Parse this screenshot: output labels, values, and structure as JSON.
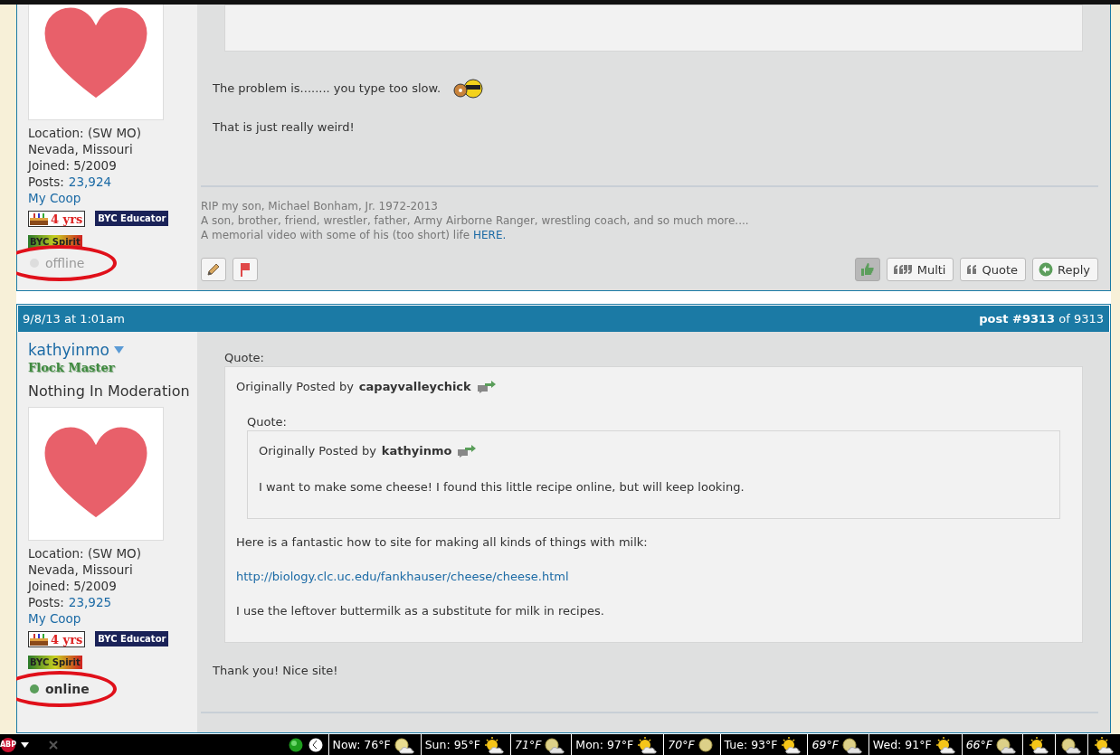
{
  "posts": [
    {
      "author": {
        "info": [
          "Location: (SW MO)",
          "Nevada, Missouri",
          "Joined: 5/2009"
        ],
        "posts_label": "Posts:",
        "posts_count": "23,924",
        "coop_link": "My Coop",
        "badges": [
          {
            "kind": "years",
            "text": "4 yrs"
          },
          {
            "kind": "educator",
            "text": "BYC Educator"
          },
          {
            "kind": "spirit",
            "text": "BYC Spirit"
          }
        ],
        "status": {
          "text": "offline",
          "online": false,
          "circled": true
        }
      },
      "content": [
        {
          "kind": "quote_end"
        },
        {
          "kind": "text",
          "text": "The problem is........ you type too slow.",
          "emoticon": true
        },
        {
          "kind": "text",
          "text": "That is just really weird!"
        }
      ],
      "signature": [
        {
          "text": "RIP my son, Michael Bonham, Jr. 1972-2013"
        },
        {
          "text": "A son, brother, friend, wrestler, father, Army Airborne Ranger, wrestling coach, and so much more...."
        },
        {
          "text": "A memorial video with some of his (too short) life",
          "link": "HERE."
        }
      ],
      "actions": [
        {
          "kind": "edit"
        },
        {
          "kind": "report"
        }
      ],
      "buttons": [
        {
          "kind": "like",
          "active": true
        },
        {
          "kind": "multi",
          "label": "Multi"
        },
        {
          "kind": "quote",
          "label": "Quote"
        },
        {
          "kind": "reply",
          "label": "Reply"
        }
      ]
    },
    {
      "header": {
        "date": "9/8/13 at 1:01am",
        "post_number": "**post #9313** of 9313"
      },
      "author": {
        "username": "kathyinmo",
        "title": "Flock Master",
        "motto": "Nothing In Moderation",
        "info": [
          "Location: (SW MO)",
          "Nevada, Missouri",
          "Joined: 5/2009"
        ],
        "posts_label": "Posts:",
        "posts_count": "23,925",
        "coop_link": "My Coop",
        "badges": [
          {
            "kind": "years",
            "text": "4 yrs"
          },
          {
            "kind": "educator",
            "text": "BYC Educator"
          },
          {
            "kind": "spirit",
            "text": "BYC Spirit"
          }
        ],
        "status": {
          "text": "online",
          "online": true,
          "circled": true
        }
      },
      "content": [
        {
          "kind": "quote",
          "label": "Quote:",
          "attribution": "Originally Posted by",
          "username": "capayvalleychick",
          "blocks": [
            {
              "kind": "quote",
              "label": "Quote:",
              "attribution": "Originally Posted by",
              "username": "kathyinmo",
              "blocks": [
                {
                  "kind": "text",
                  "text": "I want to make some cheese! I found this little recipe online, but will keep looking."
                }
              ]
            },
            {
              "kind": "text",
              "text": "Here is a fantastic how to site for making all kinds of things with milk:"
            },
            {
              "kind": "link",
              "text": "http://biology.clc.uc.edu/fankhauser/cheese/cheese.html"
            },
            {
              "kind": "text",
              "text": "I use the leftover buttermilk as a substitute for milk in recipes."
            }
          ]
        },
        {
          "kind": "text",
          "text": "Thank you! Nice site!"
        }
      ]
    }
  ],
  "taskbar": {
    "adblock": "ABP",
    "weather": [
      {
        "text": "Now: 76°F",
        "kind": "moon-cloud",
        "night": false
      },
      {
        "text": "Sun: 95°F",
        "kind": "sun-cloud",
        "night": false
      },
      {
        "text": "71°F",
        "kind": "moon-cloud",
        "night": true
      },
      {
        "text": "Mon: 97°F",
        "kind": "sun-cloud",
        "night": false
      },
      {
        "text": "70°F",
        "kind": "moon",
        "night": true
      },
      {
        "text": "Tue: 93°F",
        "kind": "sun-cloud",
        "night": false
      },
      {
        "text": "69°F",
        "kind": "moon-cloud",
        "night": true
      },
      {
        "text": "Wed: 91°F",
        "kind": "sun-cloud",
        "night": false
      },
      {
        "text": "66°F",
        "kind": "moon-cloud",
        "night": true
      },
      {
        "kind": "sun-cloud",
        "night": false
      },
      {
        "kind": "moon-cloud",
        "night": true
      },
      {
        "kind": "sun-cloud",
        "night": false
      }
    ]
  }
}
